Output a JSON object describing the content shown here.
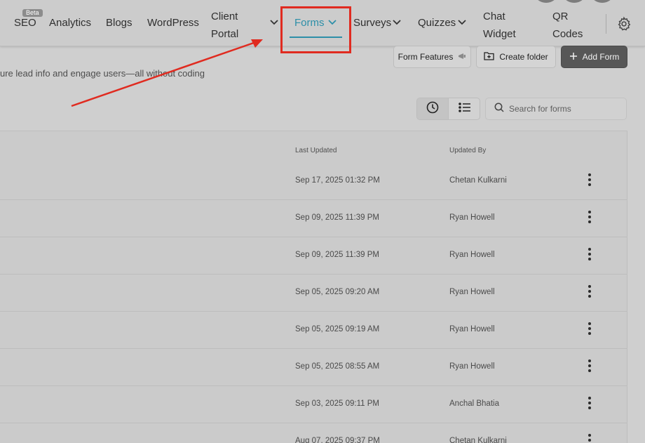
{
  "nav": {
    "seo": "SEO",
    "seo_badge": "Beta",
    "analytics": "Analytics",
    "blogs": "Blogs",
    "wordpress": "WordPress",
    "client_portal_1": "Client",
    "client_portal_2": "Portal",
    "forms": "Forms",
    "surveys": "Surveys",
    "quizzes": "Quizzes",
    "chat_widget_1": "Chat",
    "chat_widget_2": "Widget",
    "qr_codes_1": "QR",
    "qr_codes_2": "Codes"
  },
  "toolbar": {
    "form_features": "Form Features",
    "create_folder": "Create folder",
    "add_form": "Add Form"
  },
  "subtitle": "ure lead info and engage users—all without coding",
  "search": {
    "placeholder": "Search for forms"
  },
  "table": {
    "headers": {
      "last_updated": "Last Updated",
      "updated_by": "Updated By"
    },
    "rows": [
      {
        "last_updated": "Sep 17, 2025 01:32 PM",
        "updated_by": "Chetan Kulkarni"
      },
      {
        "last_updated": "Sep 09, 2025 11:39 PM",
        "updated_by": "Ryan Howell"
      },
      {
        "last_updated": "Sep 09, 2025 11:39 PM",
        "updated_by": "Ryan Howell"
      },
      {
        "last_updated": "Sep 05, 2025 09:20 AM",
        "updated_by": "Ryan Howell"
      },
      {
        "last_updated": "Sep 05, 2025 09:19 AM",
        "updated_by": "Ryan Howell"
      },
      {
        "last_updated": "Sep 05, 2025 08:55 AM",
        "updated_by": "Ryan Howell"
      },
      {
        "last_updated": "Sep 03, 2025 09:11 PM",
        "updated_by": "Anchal Bhatia"
      },
      {
        "last_updated": "Aug 07, 2025 09:37 PM",
        "updated_by": "Chetan Kulkarni"
      }
    ]
  },
  "colors": {
    "accent": "#2d8fa8",
    "annotation": "#e02b20",
    "primary_button": "#575757"
  },
  "icons": [
    "chevron-down-icon",
    "gear-icon",
    "folder-plus-icon",
    "plus-icon",
    "clock-icon",
    "list-icon",
    "search-icon",
    "kebab-menu-icon"
  ]
}
